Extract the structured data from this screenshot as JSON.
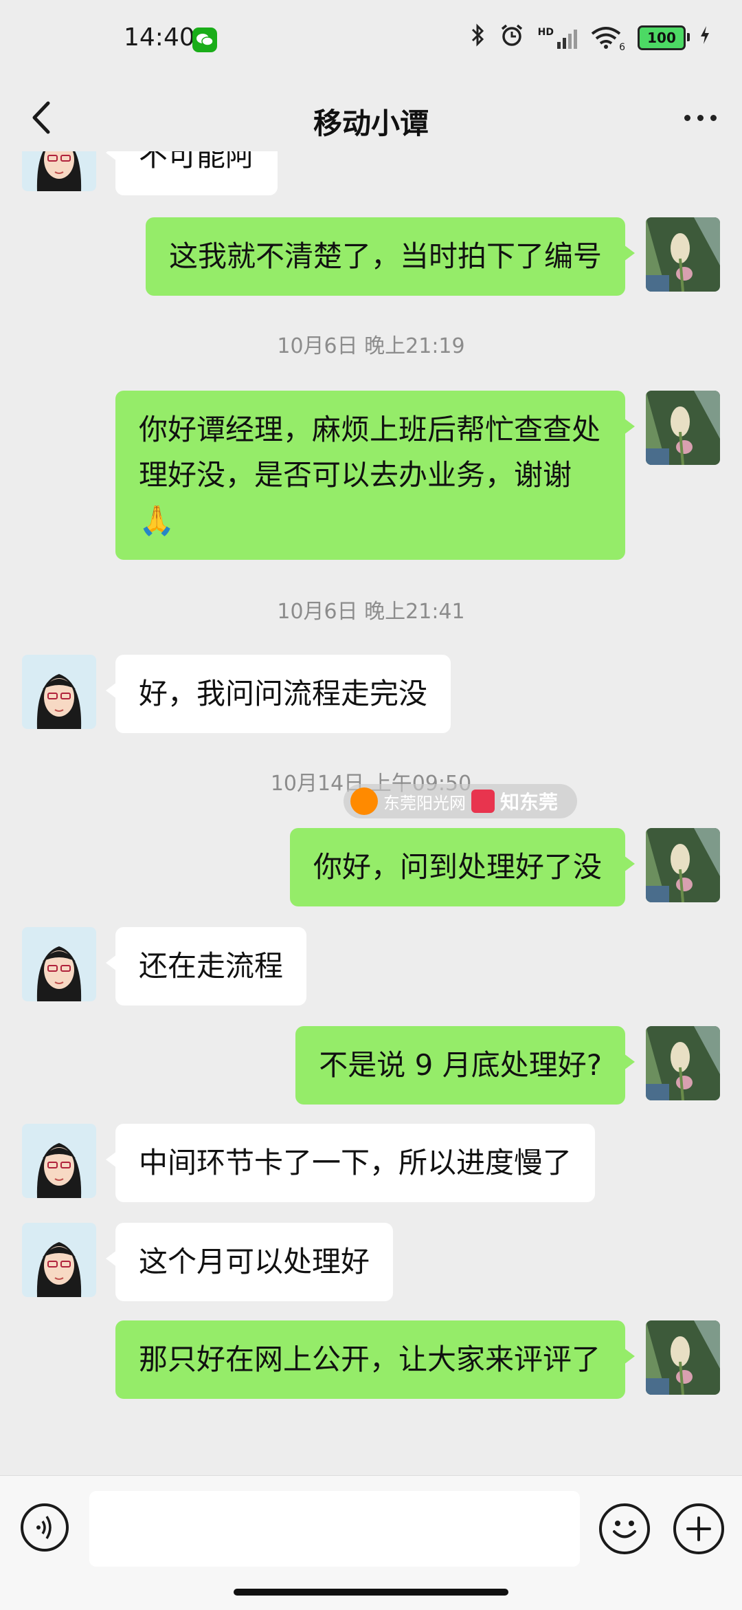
{
  "status_bar": {
    "time": "14:40",
    "network_badge": "HD",
    "wifi_label": "6",
    "battery": "100",
    "icons": [
      "wechat-icon",
      "bluetooth-icon",
      "alarm-icon",
      "signal-icon",
      "wifi-icon",
      "battery-icon",
      "charging-icon"
    ]
  },
  "header": {
    "title": "移动小谭",
    "icons": [
      "back-icon",
      "more-icon"
    ]
  },
  "messages": [
    {
      "from": "them",
      "text": "不可能阿"
    },
    {
      "from": "me",
      "text": "这我就不清楚了，当时拍下了编号"
    },
    {
      "timestamp": "10月6日 晚上21:19"
    },
    {
      "from": "me",
      "text": "你好谭经理，麻烦上班后帮忙查查处理好没，是否可以去办业务，谢谢🙏"
    },
    {
      "timestamp": "10月6日 晚上21:41"
    },
    {
      "from": "them",
      "text": "好，我问问流程走完没"
    },
    {
      "timestamp": "10月14日 上午09:50"
    },
    {
      "from": "me",
      "text": "你好，问到处理好了没"
    },
    {
      "from": "them",
      "text": "还在走流程"
    },
    {
      "from": "me",
      "text": "不是说 9 月底处理好?"
    },
    {
      "from": "them",
      "text": "中间环节卡了一下，所以进度慢了"
    },
    {
      "from": "them",
      "text": "这个月可以处理好"
    },
    {
      "from": "me",
      "text": "那只好在网上公开，让大家来评评了"
    }
  ],
  "watermark": {
    "left_text": "东莞阳光网",
    "right_text": "知东莞"
  },
  "input_bar": {
    "placeholder": "",
    "icons": [
      "voice-icon",
      "emoji-icon",
      "plus-icon"
    ]
  },
  "colors": {
    "background": "#ededed",
    "my_bubble": "#95ec69",
    "their_bubble": "#ffffff",
    "timestamp_text": "#8c8c8c"
  }
}
